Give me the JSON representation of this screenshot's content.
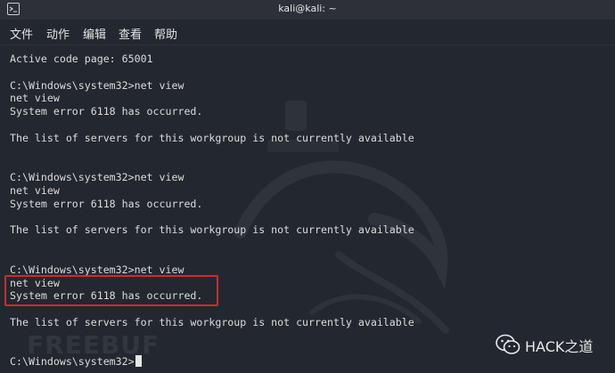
{
  "window": {
    "title": "kali@kali: ~"
  },
  "menu": {
    "items": [
      "文件",
      "动作",
      "编辑",
      "查看",
      "帮助"
    ]
  },
  "terminal": {
    "lines": [
      "Active code page: 65001",
      "",
      "C:\\Windows\\system32>net view",
      "net view",
      "System error 6118 has occurred.",
      "",
      "The list of servers for this workgroup is not currently available",
      "",
      "",
      "C:\\Windows\\system32>net view",
      "net view",
      "System error 6118 has occurred.",
      "",
      "The list of servers for this workgroup is not currently available",
      "",
      "",
      "C:\\Windows\\system32>net view",
      "net view",
      "System error 6118 has occurred.",
      "",
      "The list of servers for this workgroup is not currently available",
      "",
      "",
      "C:\\Windows\\system32>"
    ]
  },
  "watermarks": {
    "left_text": "FREEBUF",
    "right_text": "HACK之道"
  },
  "colors": {
    "background": "#23272f",
    "titlebar": "#2d3039",
    "text": "#dcdcdc",
    "highlight_border": "#d8262d"
  },
  "icons": {
    "title_icon": "terminal-icon",
    "wechat_icon": "wechat-icon"
  }
}
